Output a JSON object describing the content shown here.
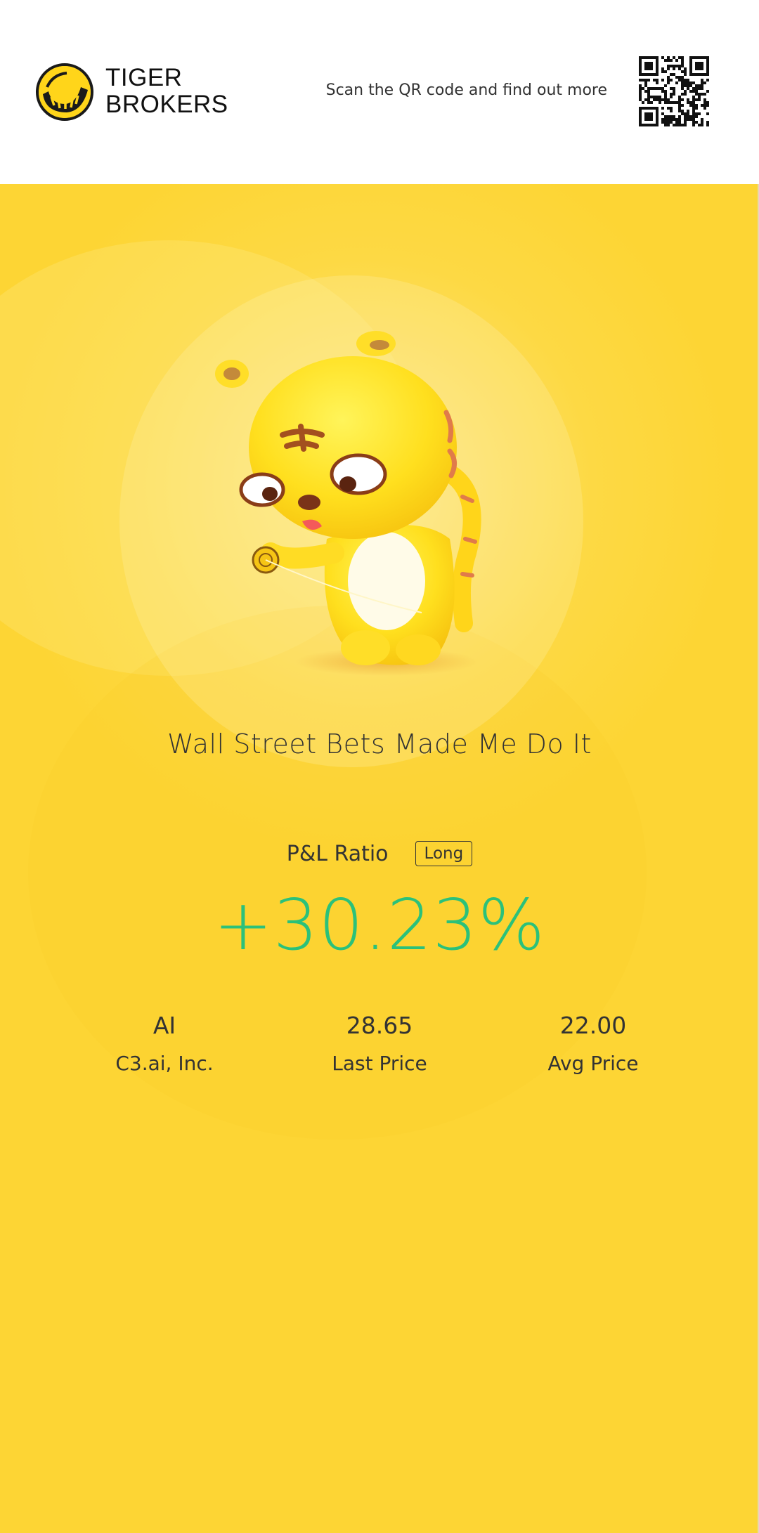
{
  "header": {
    "brand_line1": "TIGER",
    "brand_line2": "BROKERS",
    "scan_text": "Scan the QR code and find out more"
  },
  "card": {
    "title": "Wall Street Bets Made Me Do It",
    "pl_label": "P&L Ratio",
    "position_badge": "Long",
    "pl_value": "+30.23%",
    "stats": [
      {
        "value": "AI",
        "label": "C3.ai, Inc."
      },
      {
        "value": "28.65",
        "label": "Last Price"
      },
      {
        "value": "22.00",
        "label": "Avg Price"
      }
    ]
  },
  "colors": {
    "brand_yellow": "#ffd51a",
    "card_yellow": "#fdd534",
    "gain_green": "#2bc17a",
    "text_dark": "#333333"
  },
  "icons": {
    "logo": "tiger-logo-icon",
    "qr": "qr-code-icon",
    "mascot": "tiger-mascot-illustration"
  }
}
